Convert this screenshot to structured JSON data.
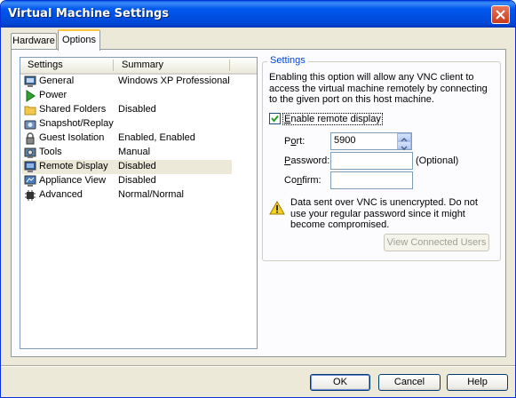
{
  "window": {
    "title": "Virtual Machine Settings"
  },
  "tabs": [
    {
      "label": "Hardware",
      "active": false
    },
    {
      "label": "Options",
      "active": true
    }
  ],
  "settings_list": {
    "columns": [
      "Settings",
      "Summary"
    ],
    "selected_index": 5,
    "items": [
      {
        "name": "General",
        "summary": "Windows XP Professional",
        "icon": "monitor-icon"
      },
      {
        "name": "Power",
        "summary": "",
        "icon": "play-icon"
      },
      {
        "name": "Shared Folders",
        "summary": "Disabled",
        "icon": "folder-icon"
      },
      {
        "name": "Snapshot/Replay",
        "summary": "",
        "icon": "camera-icon"
      },
      {
        "name": "Guest Isolation",
        "summary": "Enabled, Enabled",
        "icon": "lock-icon"
      },
      {
        "name": "Tools",
        "summary": "Manual",
        "icon": "tools-icon"
      },
      {
        "name": "Remote Display",
        "summary": "Disabled",
        "icon": "remote-display-icon"
      },
      {
        "name": "Appliance View",
        "summary": "Disabled",
        "icon": "appliance-icon"
      },
      {
        "name": "Advanced",
        "summary": "Normal/Normal",
        "icon": "chip-icon"
      }
    ]
  },
  "settings_panel": {
    "group_title": "Settings",
    "description": "Enabling this option will allow any VNC client to access the virtual machine remotely by connecting to the given port on this host machine.",
    "enable_checkbox": {
      "label": "Enable remote display",
      "checked": true
    },
    "port": {
      "label": "Port:",
      "value": "5900"
    },
    "password": {
      "label": "Password:",
      "value": "",
      "hint": "(Optional)"
    },
    "confirm": {
      "label": "Confirm:",
      "value": ""
    },
    "warning": "Data sent over VNC is unencrypted. Do not use your regular password since it might become compromised.",
    "view_users_button": "View Connected Users"
  },
  "footer": {
    "ok": "OK",
    "cancel": "Cancel",
    "help": "Help"
  },
  "colors": {
    "title_bar": "#0054E3",
    "dialog_bg": "#ECE9D8",
    "group_title": "#0046D5",
    "selected_row": "#ECE9D8"
  }
}
